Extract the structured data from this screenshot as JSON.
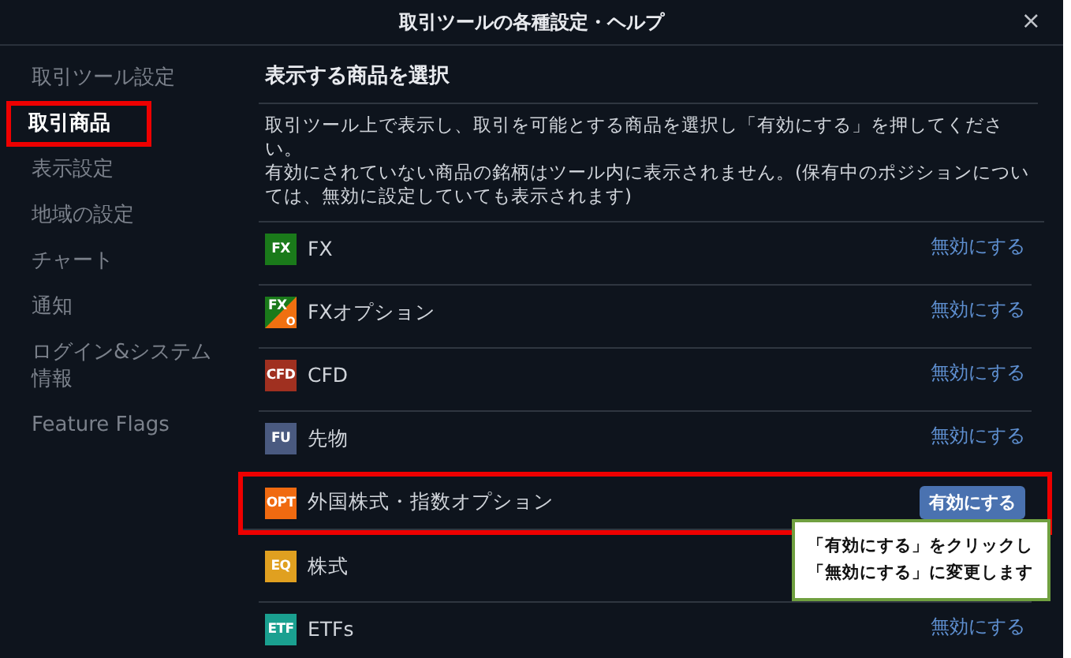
{
  "window": {
    "title": "取引ツールの各種設定・ヘルプ",
    "close": "×"
  },
  "sidebar": {
    "items": [
      {
        "label": "取引ツール設定",
        "selected": false,
        "highlighted": false
      },
      {
        "label": "取引商品",
        "selected": true,
        "highlighted": true
      },
      {
        "label": "表示設定",
        "selected": false,
        "highlighted": false
      },
      {
        "label": "地域の設定",
        "selected": false,
        "highlighted": false
      },
      {
        "label": "チャート",
        "selected": false,
        "highlighted": false
      },
      {
        "label": "通知",
        "selected": false,
        "highlighted": false
      },
      {
        "label": "ログイン&システム情報",
        "selected": false,
        "highlighted": false
      },
      {
        "label": "Feature Flags",
        "selected": false,
        "highlighted": false
      }
    ]
  },
  "content": {
    "heading": "表示する商品を選択",
    "description": [
      "取引ツール上で表示し、取引を可能とする商品を選択し「有効にする」を押してください。",
      "有効にされていない商品の銘柄はツール内に表示されません。(保有中のポジションについては、無効に設定していても表示されます)"
    ],
    "products": [
      {
        "badge": "FX",
        "color": "#1a7a1a",
        "name": "FX",
        "kind": "link",
        "highlighted": false,
        "action": "無効にする"
      },
      {
        "badge": "FX",
        "badge_corner": {
          "label": "O",
          "color": "#f07010"
        },
        "color": "#1a7a1a",
        "name": "FXオプション",
        "kind": "link",
        "highlighted": false,
        "action": "無効にする"
      },
      {
        "badge": "CFD",
        "color": "#a03020",
        "name": "CFD",
        "kind": "link",
        "highlighted": false,
        "action": "無効にする"
      },
      {
        "badge": "FU",
        "color": "#4a5a80",
        "name": "先物",
        "kind": "link",
        "highlighted": false,
        "action": "無効にする"
      },
      {
        "badge": "OPT",
        "color": "#f06a10",
        "name": "外国株式・指数オプション",
        "kind": "button",
        "highlighted": true,
        "action": "有効にする"
      },
      {
        "badge": "EQ",
        "color": "#e0a020",
        "name": "株式",
        "highlighted": false
      },
      {
        "badge": "ETF",
        "color": "#1aa090",
        "name": "ETFs",
        "kind": "link",
        "highlighted": false,
        "action": "無効にする"
      }
    ]
  },
  "callout": {
    "lines": [
      "「有効にする」をクリックし",
      "「無効にする」に変更します"
    ]
  }
}
